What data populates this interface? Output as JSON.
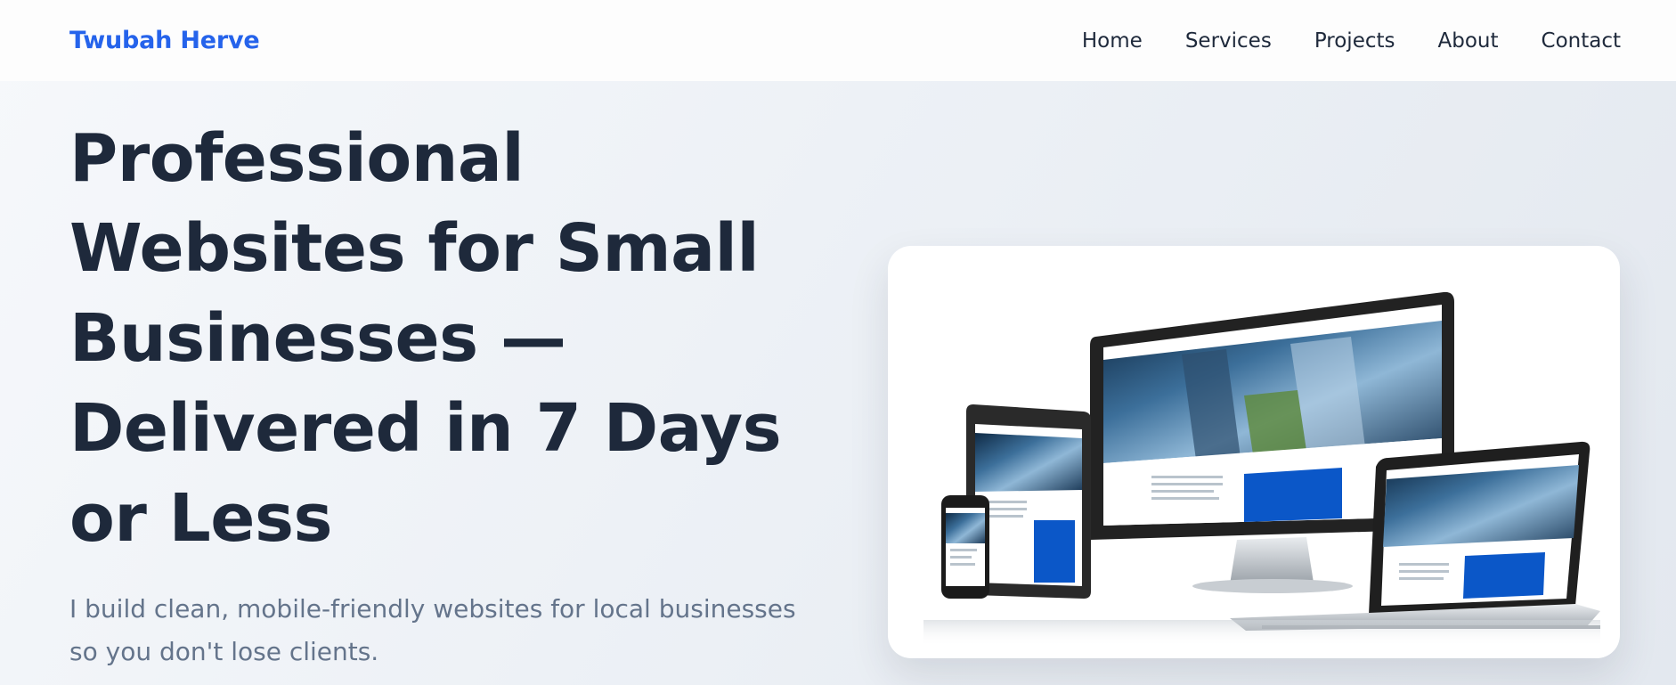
{
  "nav": {
    "brand": "Twubah Herve",
    "links": [
      "Home",
      "Services",
      "Projects",
      "About",
      "Contact"
    ]
  },
  "hero": {
    "title": "Professional Websites for Small Businesses — Delivered in 7 Days or Less",
    "subtitle": "I build clean, mobile-friendly websites for local businesses so you don't lose clients.",
    "image_alt": "Responsive website shown on desktop, laptop, tablet and phone"
  },
  "colors": {
    "brand": "#2563eb",
    "heading": "#1e293b",
    "body": "#64748b",
    "mockup_accent": "#0b57c8"
  }
}
